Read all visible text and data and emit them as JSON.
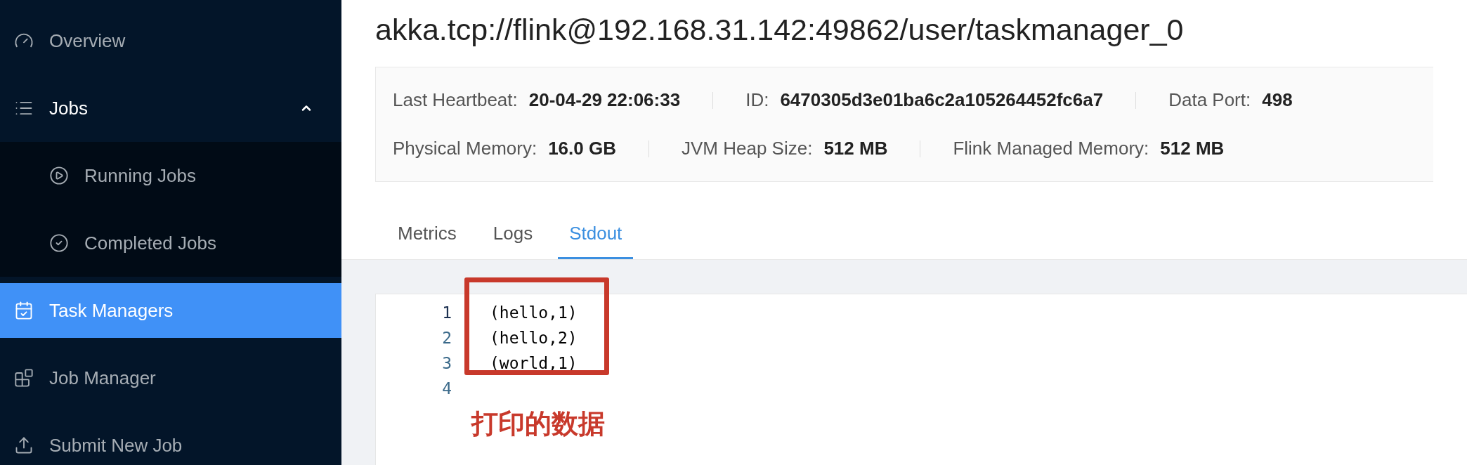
{
  "sidebar": {
    "items": [
      {
        "label": "Overview",
        "selected": false
      },
      {
        "label": "Jobs",
        "selected": false,
        "expanded": true,
        "children": [
          {
            "label": "Running Jobs",
            "selected": false
          },
          {
            "label": "Completed Jobs",
            "selected": false
          }
        ]
      },
      {
        "label": "Task Managers",
        "selected": true
      },
      {
        "label": "Job Manager",
        "selected": false
      },
      {
        "label": "Submit New Job",
        "selected": false
      }
    ]
  },
  "title": "akka.tcp://flink@192.168.31.142:49862/user/taskmanager_0",
  "info": [
    [
      {
        "label": "Last Heartbeat:",
        "value": "20-04-29 22:06:33"
      },
      {
        "label": "ID:",
        "value": "6470305d3e01ba6c2a105264452fc6a7"
      },
      {
        "label": "Data Port:",
        "value": "498"
      }
    ],
    [
      {
        "label": "Physical Memory:",
        "value": "16.0 GB"
      },
      {
        "label": "JVM Heap Size:",
        "value": "512 MB"
      },
      {
        "label": "Flink Managed Memory:",
        "value": "512 MB"
      }
    ]
  ],
  "tabs": [
    {
      "label": "Metrics",
      "selected": false
    },
    {
      "label": "Logs",
      "selected": false
    },
    {
      "label": "Stdout",
      "selected": true
    }
  ],
  "stdout": {
    "lines": [
      {
        "number": "1",
        "text": "(hello,1)"
      },
      {
        "number": "2",
        "text": "(hello,2)"
      },
      {
        "number": "3",
        "text": "(world,1)"
      },
      {
        "number": "4"
      }
    ]
  },
  "annotation": {
    "text": "打印的数据"
  }
}
